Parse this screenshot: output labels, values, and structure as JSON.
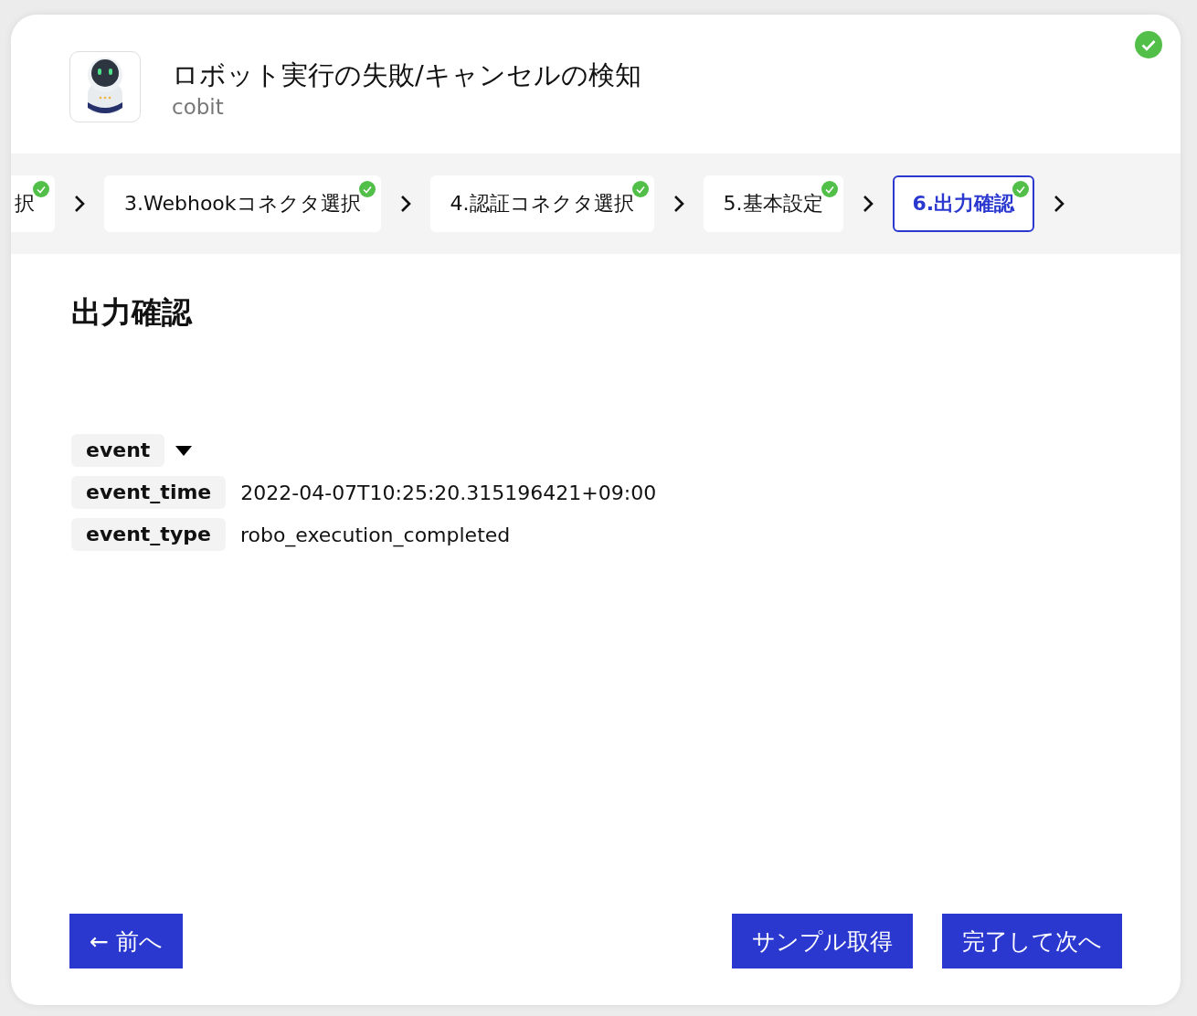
{
  "header": {
    "title": "ロボット実行の失敗/キャンセルの検知",
    "subtitle": "cobit",
    "completed": true
  },
  "steps": [
    {
      "label": "択",
      "selected": false,
      "done": true
    },
    {
      "label": "3.Webhookコネクタ選択",
      "selected": false,
      "done": true
    },
    {
      "label": "4.認証コネクタ選択",
      "selected": false,
      "done": true
    },
    {
      "label": "5.基本設定",
      "selected": false,
      "done": true
    },
    {
      "label": "6.出力確認",
      "selected": true,
      "done": true
    }
  ],
  "heading": "出力確認",
  "output": [
    {
      "key": "event",
      "kind": "group",
      "expanded": true
    },
    {
      "key": "event_time",
      "kind": "value",
      "value": "2022-04-07T10:25:20.315196421+09:00"
    },
    {
      "key": "event_type",
      "kind": "value",
      "value": "robo_execution_completed"
    }
  ],
  "buttons": {
    "back": "← 前へ",
    "sample": "サンプル取得",
    "next": "完了して次へ"
  }
}
